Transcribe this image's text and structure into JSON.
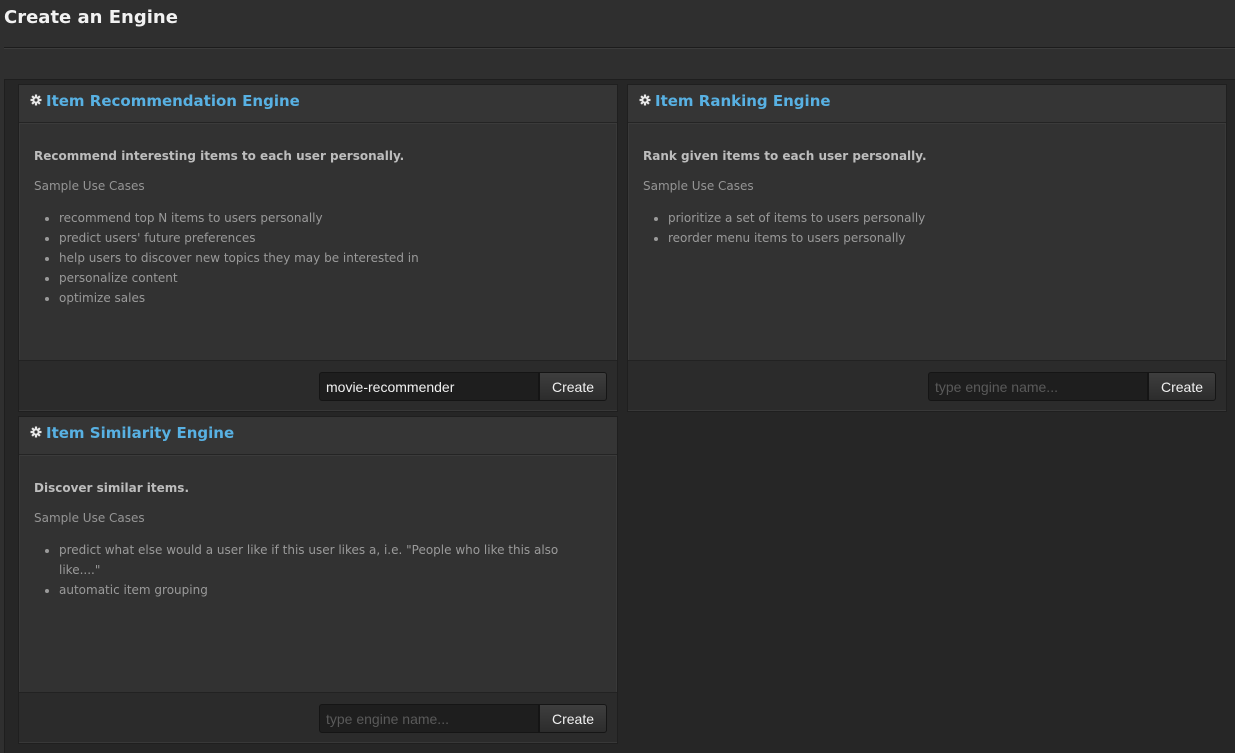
{
  "page": {
    "title": "Create an Engine"
  },
  "engines": [
    {
      "icon": "gear-icon",
      "title": "Item Recommendation Engine",
      "summary": "Recommend interesting items to each user personally.",
      "use_cases_heading": "Sample Use Cases",
      "use_cases": [
        "recommend top N items to users personally",
        "predict users' future preferences",
        "help users to discover new topics they may be interested in",
        "personalize content",
        "optimize sales"
      ],
      "input_value": "movie-recommender",
      "input_placeholder": "type engine name...",
      "button_label": "Create"
    },
    {
      "icon": "gear-icon",
      "title": "Item Ranking Engine",
      "summary": "Rank given items to each user personally.",
      "use_cases_heading": "Sample Use Cases",
      "use_cases": [
        "prioritize a set of items to users personally",
        "reorder menu items to users personally"
      ],
      "input_value": "",
      "input_placeholder": "type engine name...",
      "button_label": "Create"
    },
    {
      "icon": "gear-icon",
      "title": "Item Similarity Engine",
      "summary": "Discover similar items.",
      "use_cases_heading": "Sample Use Cases",
      "use_cases": [
        "predict what else would a user like if this user likes a, i.e. \"People who like this also like....\"",
        "automatic item grouping"
      ],
      "input_value": "",
      "input_placeholder": "type engine name...",
      "button_label": "Create"
    }
  ],
  "colors": {
    "title_accent": "#58b1e3",
    "background": "#2f2f2f",
    "card_background": "#323232"
  }
}
